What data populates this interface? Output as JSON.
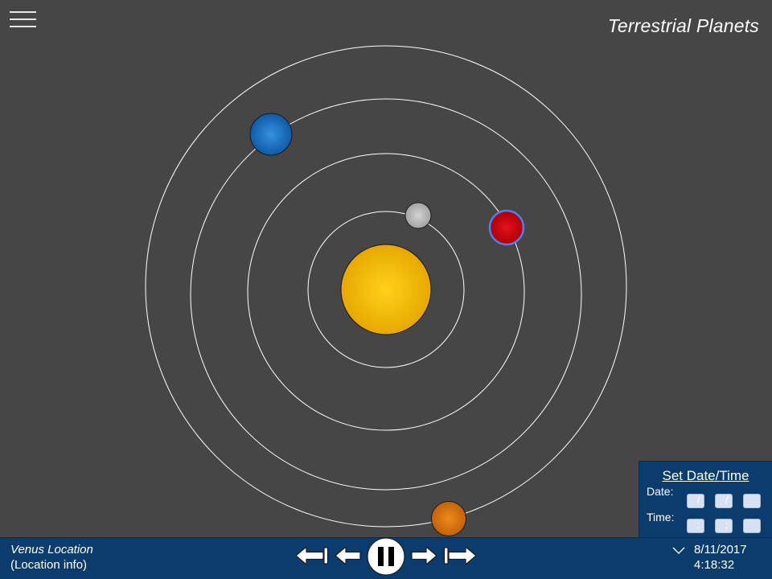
{
  "header": {
    "title": "Terrestrial Planets"
  },
  "orrery": {
    "bodies": [
      {
        "name": "sun",
        "color": "#f2b800"
      },
      {
        "name": "mercury",
        "color": "#b8b8b8"
      },
      {
        "name": "venus",
        "color": "#c8000a",
        "selected": true,
        "highlight": "#4f7ff0"
      },
      {
        "name": "earth",
        "color": "#1f6fc5"
      },
      {
        "name": "mars",
        "color": "#d8700a"
      }
    ]
  },
  "datetime_panel": {
    "title": "Set Date/Time",
    "date_label": "Date:",
    "time_label": "Time:",
    "date_sep1": "/",
    "date_sep2": "/",
    "time_sep1": ":",
    "time_sep2": ":"
  },
  "location": {
    "title": "Venus Location",
    "info": "(Location info)"
  },
  "playback": {
    "buttons": [
      "skip-back",
      "step-back",
      "pause",
      "step-forward",
      "skip-forward"
    ]
  },
  "clock": {
    "date": "8/11/2017",
    "time": "4:18:32"
  },
  "colors": {
    "background": "#464646",
    "panel": "#0c3c6e",
    "orbit": "#ffffff"
  }
}
